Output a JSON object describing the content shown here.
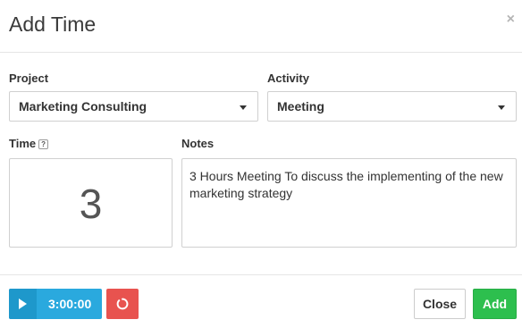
{
  "modal": {
    "title": "Add Time",
    "close_icon": "close-icon",
    "close_glyph": "×"
  },
  "form": {
    "project_label": "Project",
    "project_value": "Marketing Consulting",
    "activity_label": "Activity",
    "activity_value": "Meeting",
    "time_label": "Time",
    "time_help_glyph": "?",
    "time_value": "3",
    "notes_label": "Notes",
    "notes_value": "3 Hours Meeting To discuss the implementing of the new marketing strategy"
  },
  "footer": {
    "timer_value": "3:00:00",
    "timer_icon": "play-icon",
    "reset_icon": "reset-icon",
    "close_label": "Close",
    "add_label": "Add"
  },
  "colors": {
    "timer": "#2aa9de",
    "reset": "#e8534f",
    "add": "#2dbf4e"
  }
}
